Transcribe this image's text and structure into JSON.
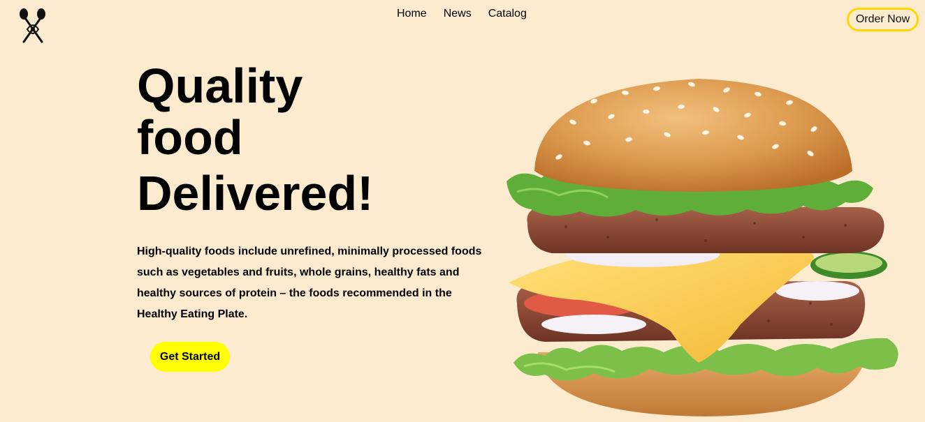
{
  "header": {
    "nav_items": [
      {
        "label": "Home"
      },
      {
        "label": "News"
      },
      {
        "label": "Catalog"
      }
    ],
    "order_button_label": "Order Now",
    "logo_icon": "fork-spoon-cross-icon"
  },
  "hero": {
    "title_lines": [
      "Quality",
      "food",
      "Delivered!"
    ],
    "description": "High-quality foods include unrefined, minimally processed foods such as vegetables and fruits, whole grains, healthy fats and healthy sources of protein – the foods recommended in the Healthy Eating Plate.",
    "cta_label": "Get Started",
    "image": "burger-image"
  },
  "colors": {
    "background": "#fdebcf",
    "order_border": "#ffd700",
    "cta_background": "#ffff00",
    "text": "#000000"
  }
}
